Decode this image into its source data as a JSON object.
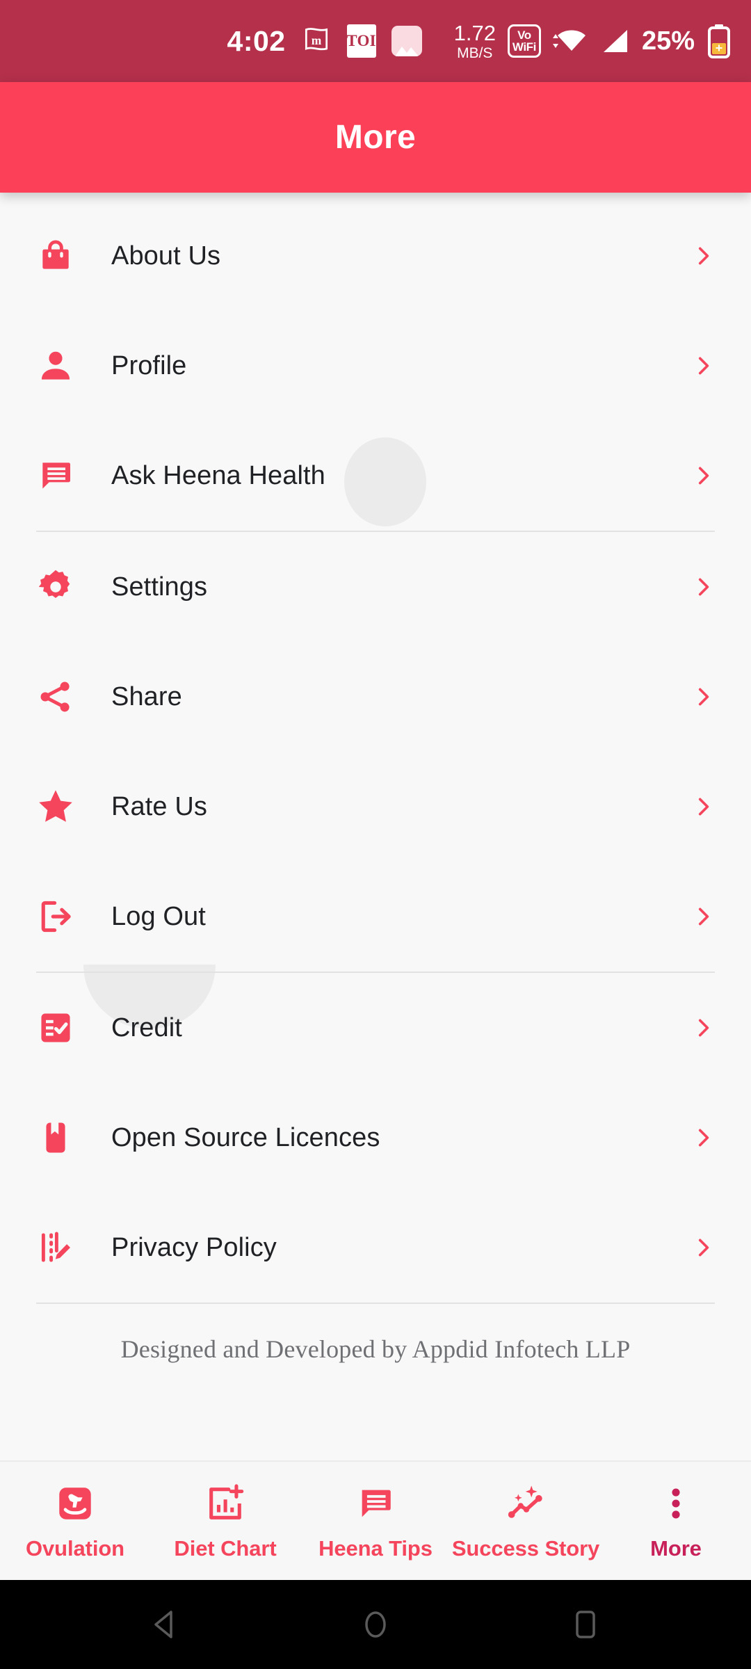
{
  "status_bar": {
    "time": "4:02",
    "icons_left": [
      "mflag-icon",
      "toi-icon",
      "gallery-icon"
    ],
    "toi_label": "TOI",
    "net_speed_value": "1.72",
    "net_speed_unit": "MB/S",
    "vowifi_line1": "Vo",
    "vowifi_line2": "WiFi",
    "icons_right": [
      "wifi-icon",
      "signal-icon",
      "battery-saver-icon"
    ],
    "battery_percent": "25%",
    "background_color": "#b5304b"
  },
  "app_bar": {
    "title": "More",
    "background_color": "#fc4057",
    "text_color": "#ffffff"
  },
  "theme": {
    "accent": "#f4455c",
    "accent_dark": "#c8215a",
    "page_background": "#f8f8f8",
    "divider": "#e2e2e2",
    "label_color": "#1f2124"
  },
  "menu": {
    "groups": [
      {
        "items": [
          {
            "label": "About Us",
            "icon": "shopping-bag-icon",
            "chevron": "chevron-right-icon"
          },
          {
            "label": "Profile",
            "icon": "person-icon",
            "chevron": "chevron-right-icon"
          },
          {
            "label": "Ask Heena Health",
            "icon": "chat-bubble-icon",
            "chevron": "chevron-right-icon"
          }
        ]
      },
      {
        "items": [
          {
            "label": "Settings",
            "icon": "gear-icon",
            "chevron": "chevron-right-icon"
          },
          {
            "label": "Share",
            "icon": "share-icon",
            "chevron": "chevron-right-icon"
          },
          {
            "label": "Rate Us",
            "icon": "star-icon",
            "chevron": "chevron-right-icon"
          },
          {
            "label": "Log Out",
            "icon": "logout-icon",
            "chevron": "chevron-right-icon"
          }
        ]
      },
      {
        "items": [
          {
            "label": "Credit",
            "icon": "checklist-icon",
            "chevron": "chevron-right-icon"
          },
          {
            "label": "Open Source Licences",
            "icon": "bookmark-icon",
            "chevron": "chevron-right-icon"
          },
          {
            "label": "Privacy Policy",
            "icon": "policy-edit-icon",
            "chevron": "chevron-right-icon"
          }
        ]
      }
    ],
    "footer_note": "Designed and Developed by Appdid Infotech LLP"
  },
  "bottom_nav": {
    "tabs": [
      {
        "label": "Ovulation",
        "icon": "rocking-horse-icon",
        "active": false
      },
      {
        "label": "Diet Chart",
        "icon": "chart-plus-icon",
        "active": false
      },
      {
        "label": "Heena Tips",
        "icon": "chat-bubble-icon",
        "active": false
      },
      {
        "label": "Success Story",
        "icon": "trending-sparkle-icon",
        "active": false
      },
      {
        "label": "More",
        "icon": "dots-vertical-icon",
        "active": true
      }
    ]
  },
  "android_nav": {
    "buttons": [
      "back-icon",
      "home-icon",
      "recents-icon"
    ]
  }
}
